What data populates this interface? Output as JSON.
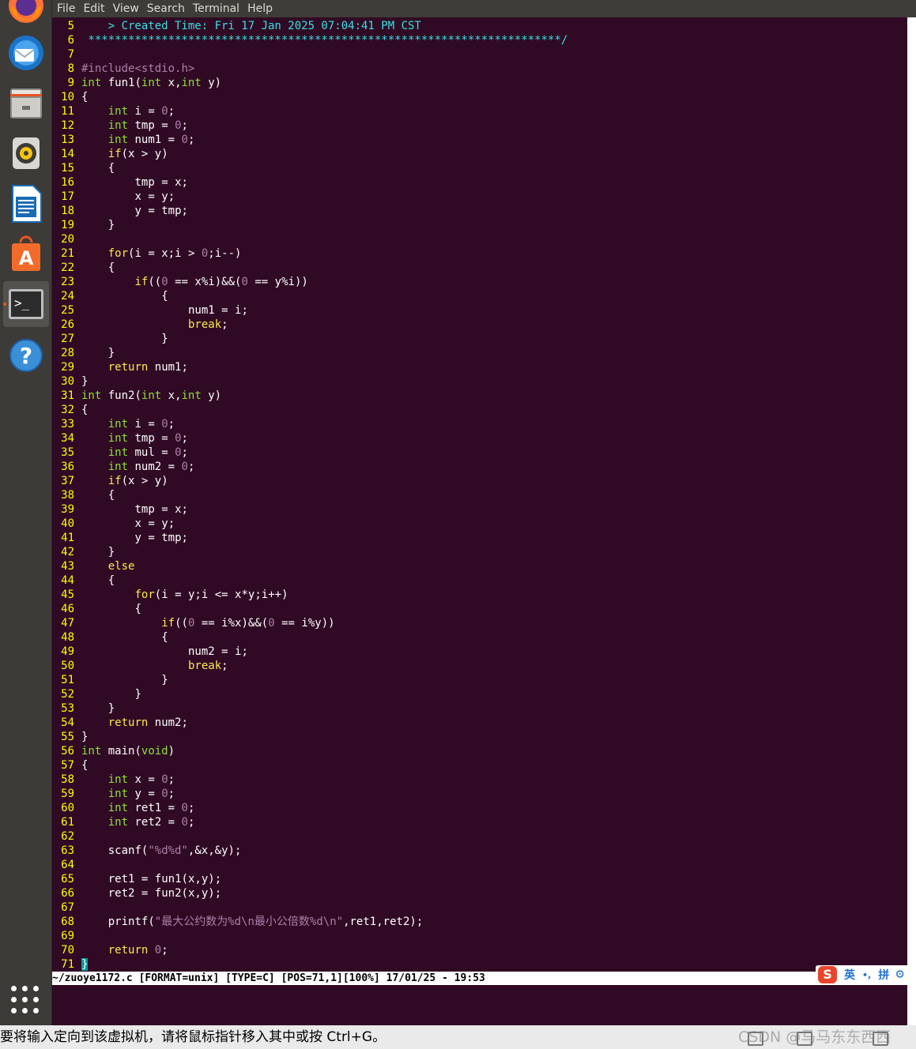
{
  "menubar": {
    "items": [
      "File",
      "Edit",
      "View",
      "Search",
      "Terminal",
      "Help"
    ]
  },
  "launcher": {
    "items": [
      {
        "name": "firefox-icon",
        "label": "Firefox"
      },
      {
        "name": "thunderbird-icon",
        "label": "Thunderbird"
      },
      {
        "name": "files-icon",
        "label": "Files"
      },
      {
        "name": "rhythmbox-icon",
        "label": "Rhythmbox"
      },
      {
        "name": "writer-icon",
        "label": "LibreOffice Writer"
      },
      {
        "name": "software-icon",
        "label": "Ubuntu Software"
      },
      {
        "name": "terminal-icon",
        "label": "Terminal"
      },
      {
        "name": "help-icon",
        "label": "Help"
      }
    ],
    "show_apps": "apps-grid-icon"
  },
  "code": [
    {
      "n": "5",
      "t": "    > Created Time: Fri 17 Jan 2025 07:04:41 PM CST"
    },
    {
      "n": "6",
      "t": " ***********************************************************************/"
    },
    {
      "n": "7",
      "t": ""
    },
    {
      "n": "8",
      "t": "#include<stdio.h>"
    },
    {
      "n": "9",
      "t": "int fun1(int x,int y)"
    },
    {
      "n": "10",
      "t": "{"
    },
    {
      "n": "11",
      "t": "    int i = 0;"
    },
    {
      "n": "12",
      "t": "    int tmp = 0;"
    },
    {
      "n": "13",
      "t": "    int num1 = 0;"
    },
    {
      "n": "14",
      "t": "    if(x > y)"
    },
    {
      "n": "15",
      "t": "    {"
    },
    {
      "n": "16",
      "t": "        tmp = x;"
    },
    {
      "n": "17",
      "t": "        x = y;"
    },
    {
      "n": "18",
      "t": "        y = tmp;"
    },
    {
      "n": "19",
      "t": "    }"
    },
    {
      "n": "20",
      "t": ""
    },
    {
      "n": "21",
      "t": "    for(i = x;i > 0;i--)"
    },
    {
      "n": "22",
      "t": "    {"
    },
    {
      "n": "23",
      "t": "        if((0 == x%i)&&(0 == y%i))"
    },
    {
      "n": "24",
      "t": "            {"
    },
    {
      "n": "25",
      "t": "                num1 = i;"
    },
    {
      "n": "26",
      "t": "                break;"
    },
    {
      "n": "27",
      "t": "            }"
    },
    {
      "n": "28",
      "t": "    }"
    },
    {
      "n": "29",
      "t": "    return num1;"
    },
    {
      "n": "30",
      "t": "}"
    },
    {
      "n": "31",
      "t": "int fun2(int x,int y)"
    },
    {
      "n": "32",
      "t": "{"
    },
    {
      "n": "33",
      "t": "    int i = 0;"
    },
    {
      "n": "34",
      "t": "    int tmp = 0;"
    },
    {
      "n": "35",
      "t": "    int mul = 0;"
    },
    {
      "n": "36",
      "t": "    int num2 = 0;"
    },
    {
      "n": "37",
      "t": "    if(x > y)"
    },
    {
      "n": "38",
      "t": "    {"
    },
    {
      "n": "39",
      "t": "        tmp = x;"
    },
    {
      "n": "40",
      "t": "        x = y;"
    },
    {
      "n": "41",
      "t": "        y = tmp;"
    },
    {
      "n": "42",
      "t": "    }"
    },
    {
      "n": "43",
      "t": "    else"
    },
    {
      "n": "44",
      "t": "    {"
    },
    {
      "n": "45",
      "t": "        for(i = y;i <= x*y;i++)"
    },
    {
      "n": "46",
      "t": "        {"
    },
    {
      "n": "47",
      "t": "            if((0 == i%x)&&(0 == i%y))"
    },
    {
      "n": "48",
      "t": "            {"
    },
    {
      "n": "49",
      "t": "                num2 = i;"
    },
    {
      "n": "50",
      "t": "                break;"
    },
    {
      "n": "51",
      "t": "            }"
    },
    {
      "n": "52",
      "t": "        }"
    },
    {
      "n": "53",
      "t": "    }"
    },
    {
      "n": "54",
      "t": "    return num2;"
    },
    {
      "n": "55",
      "t": "}"
    },
    {
      "n": "56",
      "t": "int main(void)"
    },
    {
      "n": "57",
      "t": "{"
    },
    {
      "n": "58",
      "t": "    int x = 0;"
    },
    {
      "n": "59",
      "t": "    int y = 0;"
    },
    {
      "n": "60",
      "t": "    int ret1 = 0;"
    },
    {
      "n": "61",
      "t": "    int ret2 = 0;"
    },
    {
      "n": "62",
      "t": ""
    },
    {
      "n": "63",
      "t": "    scanf(\"%d%d\",&x,&y);"
    },
    {
      "n": "64",
      "t": ""
    },
    {
      "n": "65",
      "t": "    ret1 = fun1(x,y);"
    },
    {
      "n": "66",
      "t": "    ret2 = fun2(x,y);"
    },
    {
      "n": "67",
      "t": ""
    },
    {
      "n": "68",
      "t": "    printf(\"最大公约数为%d\\n最小公倍数%d\\n\",ret1,ret2);"
    },
    {
      "n": "69",
      "t": ""
    },
    {
      "n": "70",
      "t": "    return 0;"
    },
    {
      "n": "71",
      "t": "}"
    }
  ],
  "statusline": {
    "text": "~/zuoye1172.c [FORMAT=unix] [TYPE=C] [POS=71,1][100%] 17/01/25 - 19:53"
  },
  "ime": {
    "logo": "S",
    "lang": "英",
    "punct": "•,",
    "pinyin": "拼",
    "settings": "gear-icon"
  },
  "bottombar": {
    "message": "要将输入定向到该虚拟机，请将鼠标指针移入其中或按 Ctrl+G。",
    "watermark": "CSDN @马马东东西西"
  },
  "colors": {
    "terminal_bg": "#300a24",
    "line_number": "#ffff00",
    "type": "#8ae234",
    "keyword": "#fce94f",
    "constant": "#ad7fa8",
    "comment": "#34e2e2",
    "statusline_bg": "#ffffff"
  }
}
